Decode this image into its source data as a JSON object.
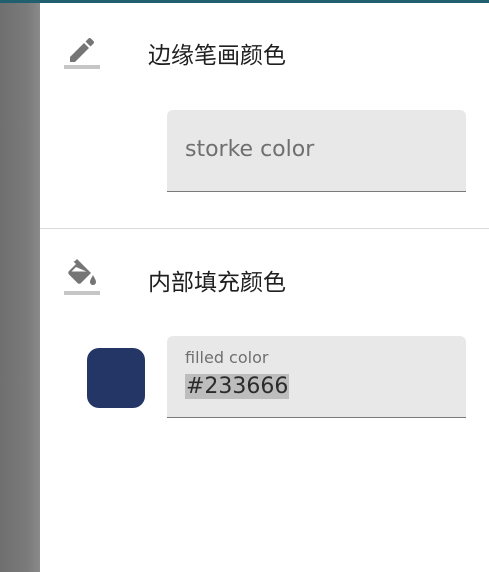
{
  "stroke_section": {
    "title": "边缘笔画颜色",
    "icon": "pencil-icon",
    "field": {
      "placeholder": "storke color",
      "value": ""
    }
  },
  "fill_section": {
    "title": "内部填充颜色",
    "icon": "paint-bucket-icon",
    "field": {
      "label": "filled color",
      "value": "#233666"
    },
    "swatch_color": "#233666"
  },
  "colors": {
    "top_border": "#1f5f6e",
    "field_background": "#e8e8e8",
    "icon_gray": "#757575"
  }
}
